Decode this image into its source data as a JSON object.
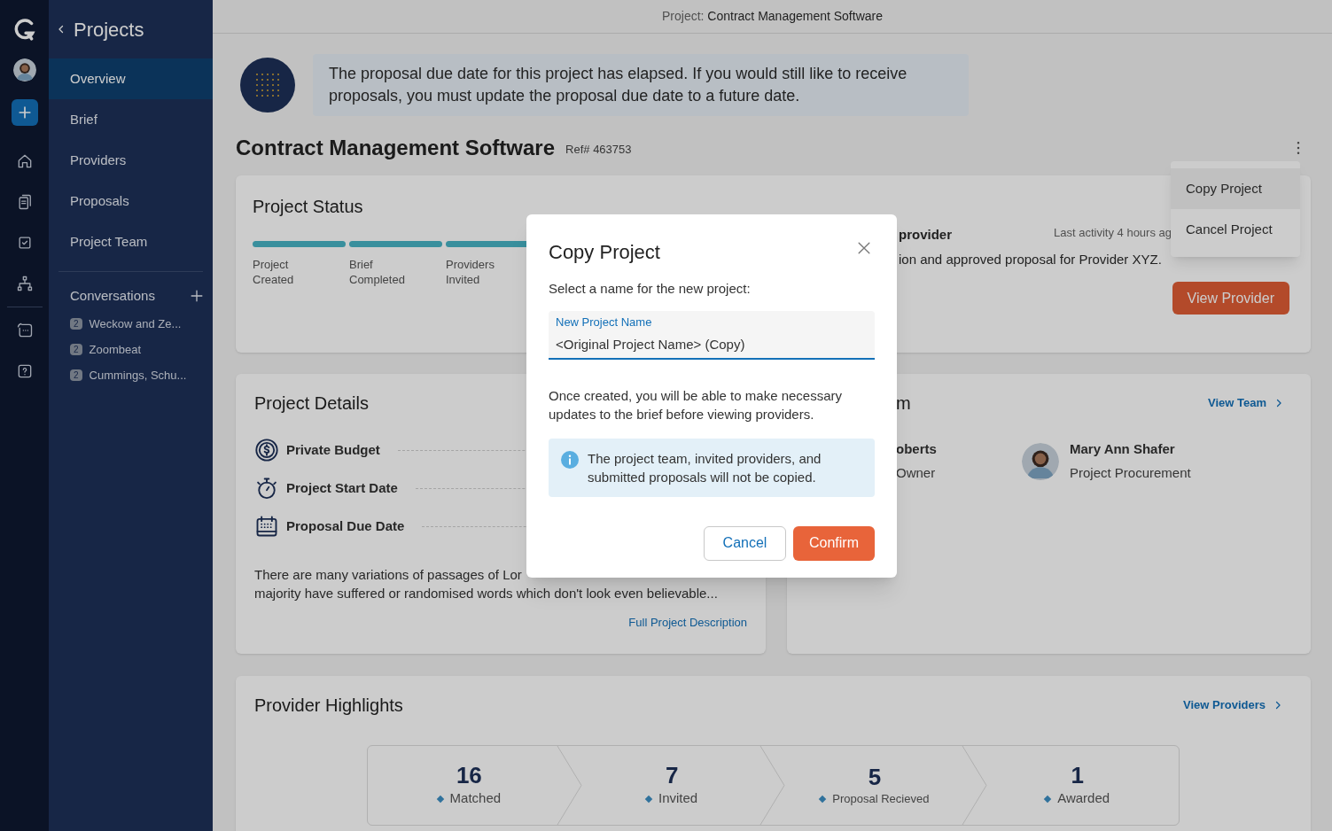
{
  "rail": {
    "items": [
      {
        "kind": "home",
        "selected": false
      },
      {
        "kind": "documents",
        "selected": false
      },
      {
        "kind": "tasks",
        "selected": false
      },
      {
        "kind": "org",
        "selected": false
      },
      {
        "kind": "chat",
        "selected": false
      },
      {
        "kind": "help",
        "selected": false
      }
    ]
  },
  "sidebar": {
    "back_title": "Projects",
    "items": [
      {
        "label": "Overview",
        "selected": true
      },
      {
        "label": "Brief",
        "selected": false
      },
      {
        "label": "Providers",
        "selected": false
      },
      {
        "label": "Proposals",
        "selected": false
      },
      {
        "label": "Project Team",
        "selected": false
      }
    ],
    "conversations": {
      "title": "Conversations",
      "items": [
        {
          "count": "2",
          "name": "Weckow and Ze..."
        },
        {
          "count": "2",
          "name": "Zoombeat"
        },
        {
          "count": "2",
          "name": "Cummings, Schu..."
        }
      ]
    }
  },
  "header": {
    "prefix": "Project:",
    "title": "Contract Management Software"
  },
  "alert": {
    "message": "The proposal due date for this project has elapsed. If you would still like to receive proposals, you must update the proposal due date to a future date."
  },
  "project": {
    "title": "Contract Management Software",
    "ref": "Ref# 463753"
  },
  "menu": {
    "items": [
      {
        "label": "Copy Project",
        "selected": true
      },
      {
        "label": "Cancel Project",
        "selected": false
      }
    ]
  },
  "status_card": {
    "title": "Project Status",
    "last_activity": "Last activity 4 hours ag",
    "steps": [
      {
        "label": "Project Created",
        "done": true
      },
      {
        "label": "Brief Completed",
        "done": true
      },
      {
        "label": "Providers Invited",
        "done": true
      }
    ],
    "heading_fragment": "provider",
    "text_fragment": "ion and approved proposal for Provider XYZ.",
    "button": "View Provider"
  },
  "details_card": {
    "title": "Project Details",
    "rows": [
      {
        "kind": "budget",
        "label": "Private Budget"
      },
      {
        "kind": "start",
        "label": "Project Start Date"
      },
      {
        "kind": "due",
        "label": "Proposal Due Date"
      }
    ],
    "description_lines": [
      "There are many variations of passages of Lor",
      "majority have suffered or randomised words which don't look even believable..."
    ],
    "link": "Full Project Description"
  },
  "team_card": {
    "title_fragment": "m",
    "link": "View Team",
    "members": [
      {
        "name": "oberts",
        "role": "Owner",
        "avatar": false
      },
      {
        "name": "Mary Ann Shafer",
        "role": "Project Procurement",
        "avatar": true
      }
    ]
  },
  "highlights": {
    "title": "Provider Highlights",
    "link": "View Providers",
    "stages": [
      {
        "count": "16",
        "label": "Matched"
      },
      {
        "count": "7",
        "label": "Invited"
      },
      {
        "count": "5",
        "label": "Proposal Recieved"
      },
      {
        "count": "1",
        "label": "Awarded"
      }
    ]
  },
  "dialog": {
    "title": "Copy Project",
    "prompt": "Select a name for the new project:",
    "field_label": "New Project Name",
    "field_value": "<Original Project Name> (Copy)",
    "note": "Once created, you will be able to make necessary updates to the brief before viewing providers.",
    "info": "The project team, invited providers, and submitted proposals will not be copied.",
    "cancel": "Cancel",
    "confirm": "Confirm"
  }
}
